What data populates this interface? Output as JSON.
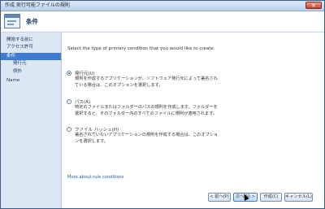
{
  "window": {
    "title": "作成 実行可能ファイルの規則"
  },
  "header": {
    "heading": "条件"
  },
  "sidebar": {
    "items": [
      {
        "label": "開始する前に",
        "active": false
      },
      {
        "label": "アクセス許可",
        "active": false
      },
      {
        "label": "条件",
        "active": true
      },
      {
        "label": "発行元",
        "active": false
      },
      {
        "label": "例外",
        "active": false
      },
      {
        "label": "Name",
        "active": false
      }
    ]
  },
  "main": {
    "instruction": "Select the type of primary condition that you would like to create.",
    "options": [
      {
        "label": "発行元(U)",
        "selected": true,
        "description": "規則を作成するアプリケーションが、ソフトウェア発行元によって署名されている場合は、このオプションを選択します。"
      },
      {
        "label": "パス(A)",
        "selected": false,
        "description": "特定のファイルまたはフォルダーのパスの規則を作成します。フォルダーを選択すると、そのフォルダー内のすべてのファイルに規則が適用されます。"
      },
      {
        "label": "ファイル ハッシュ(H)",
        "selected": false,
        "description": "署名されていないアプリケーションの規則を作成する場合は、このオプションを選択します。"
      }
    ],
    "more_link": "More about rule conditions"
  },
  "buttons": {
    "back": "< 前へ(P)",
    "next": "次へ(N) >",
    "create": "作成(C)",
    "cancel": "キャンセル(L)"
  }
}
